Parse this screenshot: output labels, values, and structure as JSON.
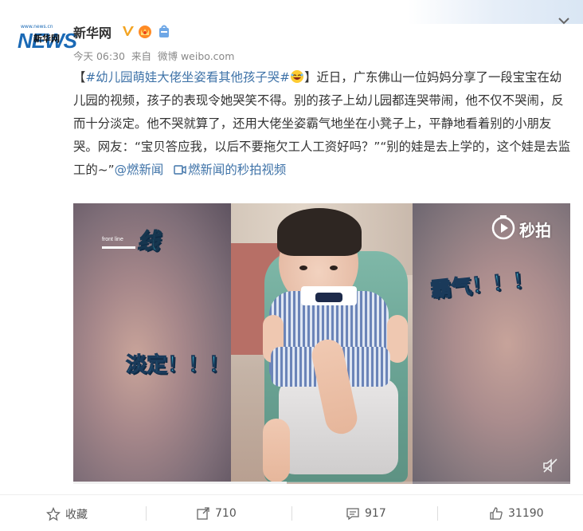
{
  "header": {
    "name": "新华网",
    "avatar_text_big": "NEWS",
    "avatar_text_cn": "新华网",
    "avatar_url": "www.news.cn",
    "time": "今天 06:30",
    "source_prefix": "来自",
    "source": "微博 weibo.com"
  },
  "post": {
    "bracket_open": "【",
    "topic": "#幼儿园萌娃大佬坐姿看其他孩子哭#",
    "bracket_close": "】",
    "body": "近日，广东佛山一位妈妈分享了一段宝宝在幼儿园的视频，孩子的表现令她哭笑不得。别的孩子上幼儿园都连哭带闹，他不仅不哭闹，反而十分淡定。他不哭就算了，还用大佬坐姿霸气地坐在小凳子上，平静地看着别的小朋友哭。网友：“宝贝答应我，以后不要拖欠工人工资好吗？”“别的娃是去上学的，这个娃是去监工的~”",
    "mention": "@燃新闻",
    "video_link": "燃新闻的秒拍视频"
  },
  "video": {
    "caption_left": "淡定！！！",
    "caption_right": "霸气！！！",
    "frontline_text": "front line",
    "frontline_cn": "线",
    "watermark": "秒拍",
    "progress_fraction": 0.43
  },
  "actions": {
    "favorite": "收藏",
    "repost": "710",
    "comment": "917",
    "like": "31190"
  },
  "colors": {
    "link": "#3f73a8",
    "topic": "#eb7350",
    "caption": "#3fc1d6"
  }
}
